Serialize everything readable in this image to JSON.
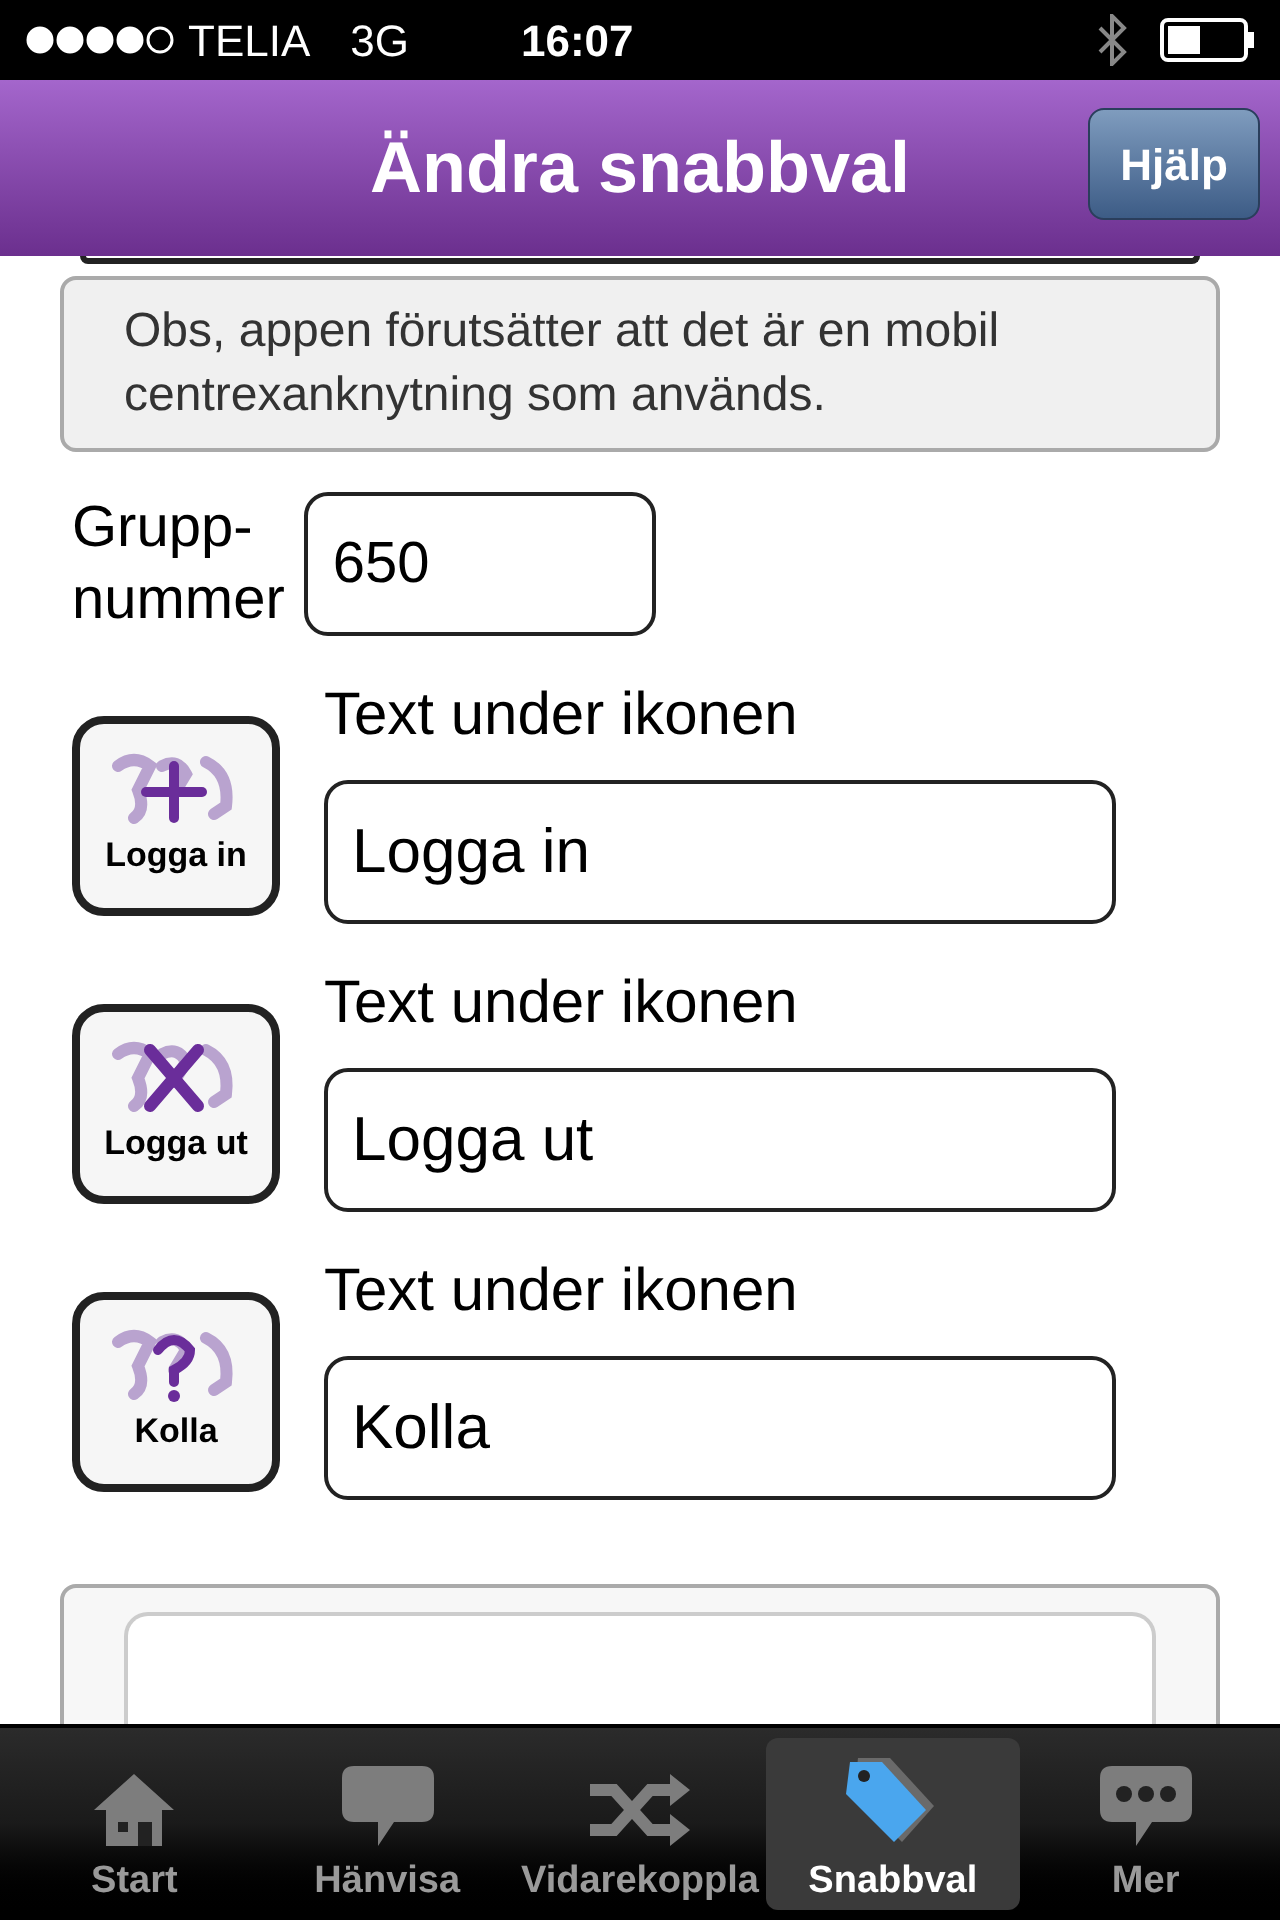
{
  "status_bar": {
    "carrier": "TELIA",
    "network": "3G",
    "time": "16:07"
  },
  "header": {
    "title": "Ändra snabbval",
    "help_button": "Hjälp"
  },
  "notice": "Obs, appen förutsätter att det är en mobil centrexanknytning som används.",
  "group_number": {
    "label": "Grupp-\nnummer",
    "value": "650"
  },
  "shortcuts": [
    {
      "kind": "plus",
      "tile_label": "Logga in",
      "field_label": "Text under ikonen",
      "value": "Logga in"
    },
    {
      "kind": "cross",
      "tile_label": "Logga ut",
      "field_label": "Text under ikonen",
      "value": "Logga ut"
    },
    {
      "kind": "question",
      "tile_label": "Kolla",
      "field_label": "Text under ikonen",
      "value": "Kolla"
    }
  ],
  "tab_bar": [
    {
      "kind": "home",
      "label": "Start",
      "selected": false
    },
    {
      "kind": "bubble",
      "label": "Hänvisa",
      "selected": false
    },
    {
      "kind": "shuffle",
      "label": "Vidarekoppla",
      "selected": false
    },
    {
      "kind": "tag",
      "label": "Snabbval",
      "selected": true
    },
    {
      "kind": "dots",
      "label": "Mer",
      "selected": false
    }
  ]
}
